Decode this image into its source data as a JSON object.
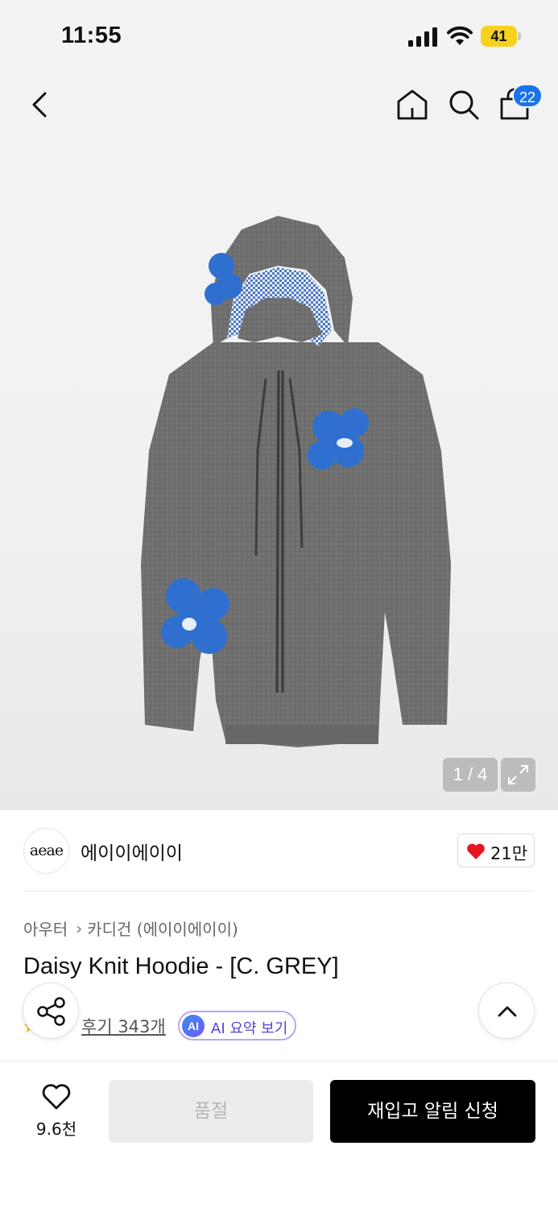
{
  "status_bar": {
    "time": "11:55",
    "battery": "41",
    "icons": [
      "signal-icon",
      "wifi-icon",
      "battery-icon"
    ]
  },
  "nav": {
    "icons": [
      "back-icon",
      "home-icon",
      "search-icon",
      "shopping-bag-icon"
    ],
    "cart_count": "22"
  },
  "gallery": {
    "counter": "1 / 4",
    "expand_icon": "expand-icon",
    "product_colors": {
      "knit": "#6e6e6e",
      "flower": "#2f6fd0"
    }
  },
  "brand": {
    "logo_text": "aeae",
    "name": "에이이에이이",
    "like_count": "21만"
  },
  "breadcrumb": {
    "items": [
      "아우터",
      "카디건 (에이이에이이)"
    ]
  },
  "product": {
    "title": "Daisy Knit Hoodie - [C. GREY]",
    "review_link": "후기 343개",
    "ai_badge": "AI",
    "ai_summary_label": "AI 요약 보기"
  },
  "floating": {
    "share_icon": "share-icon",
    "top_icon": "chevron-up-icon"
  },
  "bottom_bar": {
    "wish_count": "9.6천",
    "soldout_label": "품절",
    "restock_label": "재입고 알림 신청"
  },
  "colors": {
    "accent_blue": "#1a73e8",
    "heart_red": "#e5141e",
    "ai_purple": "#5b3fd6",
    "cta_black": "#000000"
  }
}
